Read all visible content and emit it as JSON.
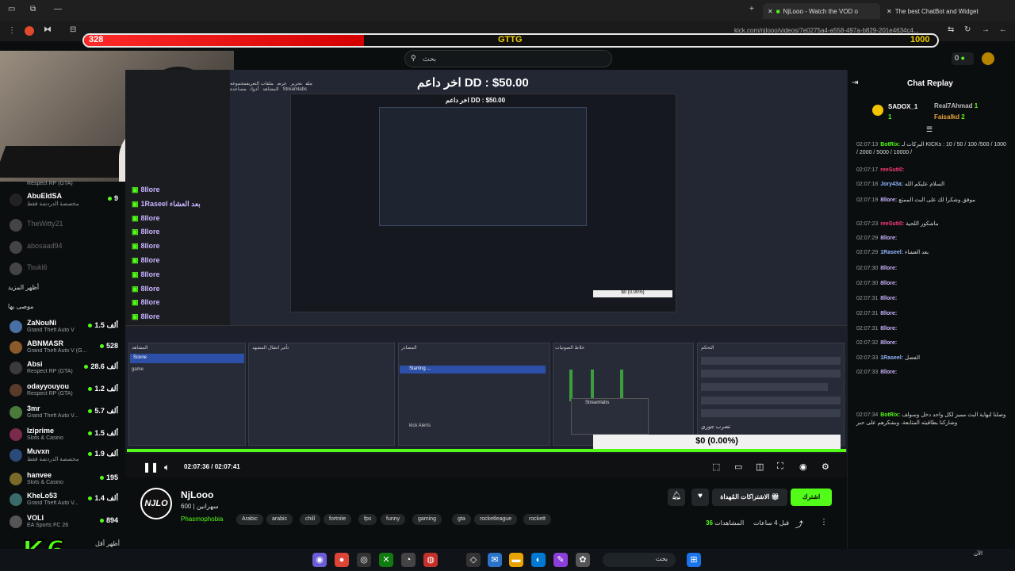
{
  "browser": {
    "tabs": [
      {
        "label": "NjLooo - Watch the VOD o",
        "active": true
      },
      {
        "label": "The best ChatBot and Widget",
        "active": false
      }
    ],
    "url": "kick.com/njlooo/videos/7e0275a4-a558-497a-b829-201e4634c4..."
  },
  "overlay": {
    "goal_current": "328",
    "goal_label": "GTTG",
    "goal_target": "1000",
    "progress_fraction": 0.328,
    "last_donation": "اخر داعم DD : $50.00",
    "money_box": "$0 (0.00%)"
  },
  "header": {
    "search_placeholder": "بحث",
    "coins": "0"
  },
  "sidebar": {
    "top_entries": [
      {
        "name": "",
        "game": "Respect RP (GTA)",
        "count": ""
      },
      {
        "name": "AbuEIdSA",
        "game": "مخصصة الدردشة فقط",
        "count": "9"
      },
      {
        "name": "TheWitty21",
        "game": "",
        "count": ""
      },
      {
        "name": "abosaad94",
        "game": "",
        "count": ""
      },
      {
        "name": "Tsuki6",
        "game": "",
        "count": ""
      }
    ],
    "show_more_1": "أظهر المزيد",
    "recommended_heading": "موصى بها",
    "recommended": [
      {
        "name": "ZaNouNi",
        "game": "Grand Theft Auto V",
        "count": "1.5 ألف"
      },
      {
        "name": "ABNMASR",
        "game": "Grand Theft Auto V (G...",
        "count": "528"
      },
      {
        "name": "Absi",
        "game": "Respect RP (GTA)",
        "count": "28.6 ألف"
      },
      {
        "name": "odayyouyou",
        "game": "Respect RP (GTA)",
        "count": "1.2 ألف"
      },
      {
        "name": "3mr",
        "game": "Grand Theft Auto V...",
        "count": "5.7 ألف"
      },
      {
        "name": "Iziprime",
        "game": "Slots & Casino",
        "count": "1.5 ألف"
      },
      {
        "name": "Muvxn",
        "game": "مخصصة الدردشة فقط",
        "count": "1.9 ألف"
      },
      {
        "name": "hanvee",
        "game": "Slots & Casino",
        "count": "195"
      },
      {
        "name": "KheLo53",
        "game": "Grand Theft Auto V...",
        "count": "1.4 ألف"
      },
      {
        "name": "VOLI",
        "game": "EA Sports FC 26",
        "count": "894"
      }
    ],
    "show_more_2": "أظهر أقل"
  },
  "logo_text": "K6",
  "obs": {
    "menu": [
      "ملف",
      "تحرير",
      "عرض",
      "ملفات التعريف",
      "مجموعة المشاهد",
      "أدوات",
      "مساعدة",
      "Streamlabs"
    ],
    "chat_lines": [
      "8llore",
      "1Raseel بعد العشاء",
      "8llore",
      "8llore",
      "8llore",
      "8llore",
      "8llore",
      "8llore",
      "8llore",
      "8llore",
      "1Raseel الفضل"
    ],
    "docks": [
      "المشاهد",
      "تأثير انتقال المشهد",
      "المصادر",
      "خلاط الصوتيات",
      "التحكم"
    ],
    "scene_selected": "Scene",
    "scene_2": "game",
    "source_selected": "Starting ...",
    "source_kick": "kick Alerts",
    "popup_title": "Streamlabs",
    "control_label": "تضرب جوري",
    "preview_donation": "اخر داعم DD : $50.00",
    "preview_money": "$0 (0.00%)"
  },
  "player": {
    "time": "02:07:36 / 02:07:41",
    "progress_fraction": 0.999
  },
  "channel": {
    "name": "NjLooo",
    "avatar_text": "NJLO",
    "subtitle": "600 | سهرانين",
    "game": "Phasmophobia",
    "tags": [
      "Arabic",
      "arabic",
      "chill",
      "fortnite",
      "fps",
      "funny",
      "gaming",
      "gta",
      "rocketleague",
      "rockett"
    ],
    "follow": "اشترك",
    "subscriptions": "الاشتراكات المُهداة",
    "views_label": "المشاهدات",
    "views": "36",
    "ago": "قبل 4 ساعات"
  },
  "chat": {
    "title": "Chat Replay",
    "gifters": [
      {
        "name": "SADOX_1",
        "count": "1",
        "color": "#f5c400"
      },
      {
        "name": "Real7Ahmad",
        "count": "1",
        "color": "#bbbbbb"
      },
      {
        "name": "Faisalkd",
        "count": "2",
        "color": "#e8a33a"
      }
    ],
    "messages": [
      {
        "ts": "02:07:13",
        "user": "BotRix:",
        "color": "#53fc18",
        "text": "البركات لـ KICKs : 10 / 50 / 100 /500 / 1000 / 2000 / 5000 / 10000 /"
      },
      {
        "ts": "02:07:17",
        "user": "reeSuti0:",
        "color": "#ff3b7a",
        "text": ""
      },
      {
        "ts": "02:07:18",
        "user": "Jory43a:",
        "color": "#8fb8ff",
        "text": "السلام عليكم الله"
      },
      {
        "ts": "02:07:19",
        "user": "8llore:",
        "color": "#c9b3ff",
        "text": "موفق وشكرا لك على البث الممتع"
      },
      {
        "ts": "02:07:23",
        "user": "reeSuti0:",
        "color": "#ff3b7a",
        "text": "ماشكور اللحية"
      },
      {
        "ts": "02:07:29",
        "user": "8llore:",
        "color": "#c9b3ff",
        "text": ""
      },
      {
        "ts": "02:07:29",
        "user": "1Raseel:",
        "color": "#8fb8ff",
        "text": "بعد العشاء"
      },
      {
        "ts": "02:07:30",
        "user": "8llore:",
        "color": "#c9b3ff",
        "text": ""
      },
      {
        "ts": "02:07:30",
        "user": "8llore:",
        "color": "#c9b3ff",
        "text": ""
      },
      {
        "ts": "02:07:31",
        "user": "8llore:",
        "color": "#c9b3ff",
        "text": ""
      },
      {
        "ts": "02:07:31",
        "user": "8llore:",
        "color": "#c9b3ff",
        "text": ""
      },
      {
        "ts": "02:07:31",
        "user": "8llore:",
        "color": "#c9b3ff",
        "text": ""
      },
      {
        "ts": "02:07:32",
        "user": "8llore:",
        "color": "#c9b3ff",
        "text": ""
      },
      {
        "ts": "02:07:33",
        "user": "1Raseel:",
        "color": "#8fb8ff",
        "text": "الفضل"
      },
      {
        "ts": "02:07:33",
        "user": "8llore:",
        "color": "#c9b3ff",
        "text": ""
      },
      {
        "ts": "02:07:34",
        "user": "BotRix:",
        "color": "#53fc18",
        "text": "وصلنا لنهاية البث مميز لكل واحد دخل وسولف وشاركنا بطاقيته المتابعة، وبشكرهم على حبر"
      }
    ]
  },
  "taskbar": {
    "search": "بحث",
    "clock": "الآن"
  },
  "colors": {
    "kick_green": "#53fc18",
    "bg": "#0b0e0f",
    "goal_red": "#e01010"
  }
}
